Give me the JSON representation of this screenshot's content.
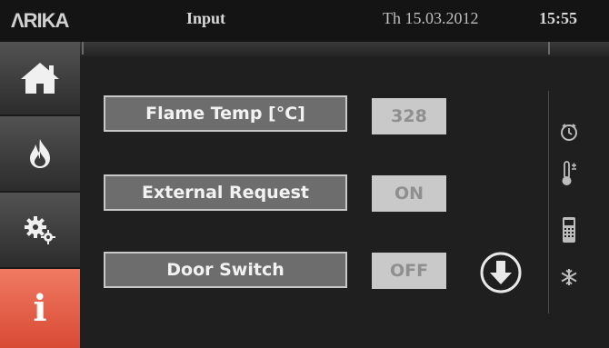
{
  "header": {
    "logo": "ΛRIKA",
    "title": "Input",
    "date": "Th 15.03.2012",
    "time": "15:55"
  },
  "sidebar": {
    "items": [
      {
        "name": "home",
        "icon": "home-icon"
      },
      {
        "name": "flame",
        "icon": "flame-icon"
      },
      {
        "name": "settings",
        "icon": "gears-icon"
      },
      {
        "name": "info",
        "icon": "info-icon",
        "glyph": "i",
        "active": true
      }
    ]
  },
  "rows": [
    {
      "label": "Flame Temp [°C]",
      "value": "328"
    },
    {
      "label": "External Request",
      "value": "ON"
    },
    {
      "label": "Door Switch",
      "value": "OFF"
    }
  ],
  "right_panel": {
    "icons": [
      "clock-icon",
      "thermometer-icon",
      "remote-control-icon",
      "snowflake-icon"
    ]
  },
  "colors": {
    "accent": "#e0563f",
    "label_bg": "#6d6d6d",
    "value_bg": "#c9c9c9"
  }
}
